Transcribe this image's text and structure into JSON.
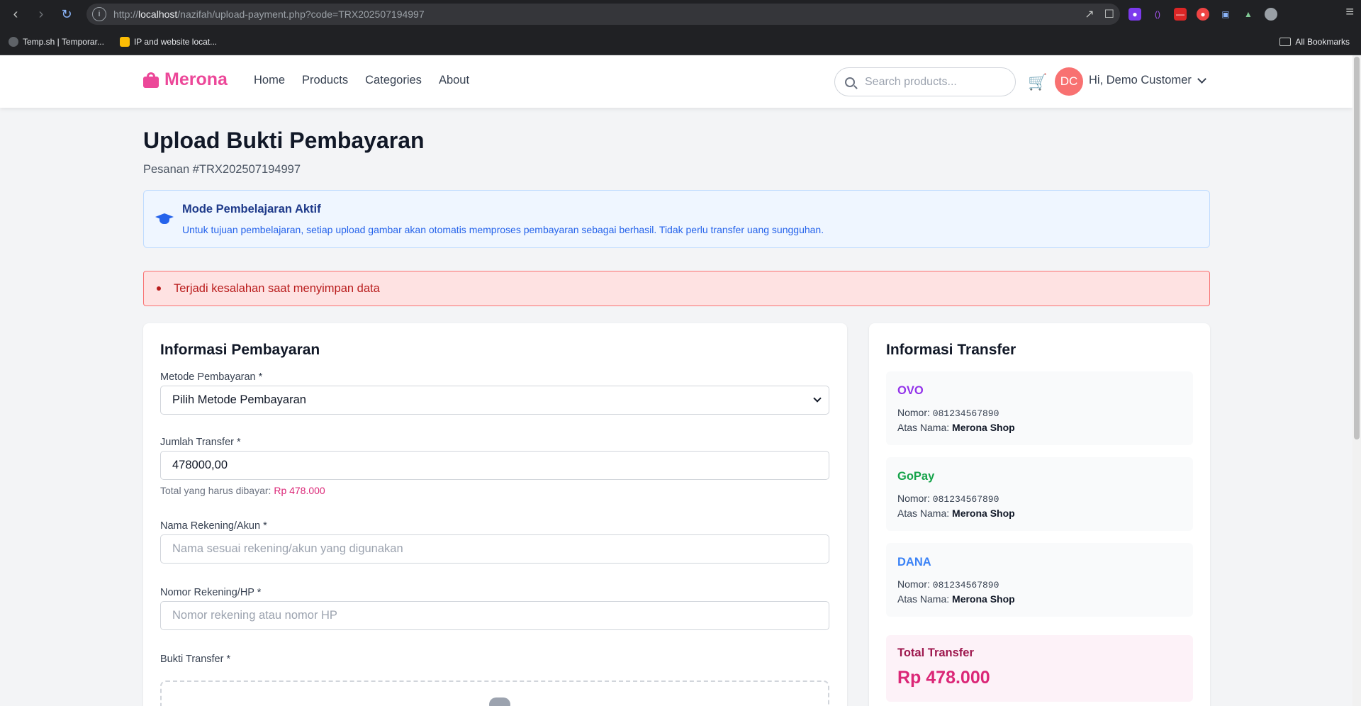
{
  "browser": {
    "url_prefix": "http://",
    "url_host": "localhost",
    "url_path": "/nazifah/upload-payment.php?code=TRX202507194997",
    "bookmarks": [
      "Temp.sh | Temporar...",
      "IP and website locat..."
    ],
    "all_bookmarks": "All Bookmarks"
  },
  "header": {
    "brand": "Merona",
    "nav": [
      "Home",
      "Products",
      "Categories",
      "About"
    ],
    "search_placeholder": "Search products...",
    "avatar_initials": "DC",
    "greeting": "Hi, Demo Customer"
  },
  "page": {
    "title": "Upload Bukti Pembayaran",
    "order": "Pesanan #TRX202507194997"
  },
  "info": {
    "title": "Mode Pembelajaran Aktif",
    "text": "Untuk tujuan pembelajaran, setiap upload gambar akan otomatis memproses pembayaran sebagai berhasil. Tidak perlu transfer uang sungguhan."
  },
  "error": {
    "message": "Terjadi kesalahan saat menyimpan data"
  },
  "payment_form": {
    "title": "Informasi Pembayaran",
    "method_label": "Metode Pembayaran *",
    "method_value": "Pilih Metode Pembayaran",
    "amount_label": "Jumlah Transfer *",
    "amount_value": "478000,00",
    "total_hint": "Total yang harus dibayar:",
    "total_hint_value": "Rp 478.000",
    "account_name_label": "Nama Rekening/Akun *",
    "account_name_placeholder": "Nama sesuai rekening/akun yang digunakan",
    "account_number_label": "Nomor Rekening/HP *",
    "account_number_placeholder": "Nomor rekening atau nomor HP",
    "proof_label": "Bukti Transfer *"
  },
  "transfer_info": {
    "title": "Informasi Transfer",
    "number_label": "Nomor:",
    "name_label": "Atas Nama:",
    "methods": [
      {
        "name": "OVO",
        "number": "081234567890",
        "holder": "Merona Shop",
        "color": "#9333ea"
      },
      {
        "name": "GoPay",
        "number": "081234567890",
        "holder": "Merona Shop",
        "color": "#16a34a"
      },
      {
        "name": "DANA",
        "number": "081234567890",
        "holder": "Merona Shop",
        "color": "#3b82f6"
      }
    ],
    "total_label": "Total Transfer",
    "total_value": "Rp 478.000"
  },
  "colors": {
    "brand": "#ec4899",
    "error": "#b91c1c",
    "info": "#2563eb"
  }
}
